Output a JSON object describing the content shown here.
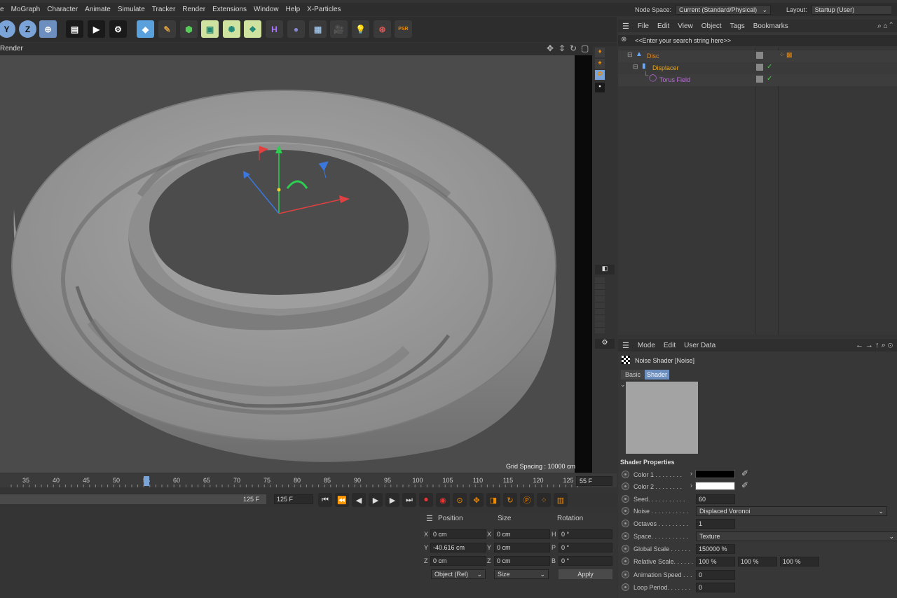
{
  "menubar": {
    "items": [
      "e",
      "MoGraph",
      "Character",
      "Animate",
      "Simulate",
      "Tracker",
      "Render",
      "Extensions",
      "Window",
      "Help",
      "X-Particles"
    ]
  },
  "nodespace": {
    "label": "Node Space:",
    "value": "Current (Standard/Physical)"
  },
  "layout": {
    "label": "Layout:",
    "value": "Startup (User)"
  },
  "viewport": {
    "menu_label": "Render",
    "grid_spacing": "Grid Spacing : 10000 cm"
  },
  "timeline": {
    "ticks": [
      "35",
      "40",
      "45",
      "50",
      "55",
      "60",
      "65",
      "70",
      "75",
      "80",
      "85",
      "90",
      "95",
      "100",
      "105",
      "110",
      "115",
      "120",
      "125"
    ],
    "current_frame": "55 F",
    "end_frame": "125 F",
    "end_frame_field": "125 F"
  },
  "coords": {
    "headers": [
      "Position",
      "Size",
      "Rotation"
    ],
    "rows": [
      {
        "axis": "X",
        "pos": "0 cm",
        "size_axis": "X",
        "size": "0 cm",
        "rot_axis": "H",
        "rot": "0 °"
      },
      {
        "axis": "Y",
        "pos": "-40.616 cm",
        "size_axis": "Y",
        "size": "0 cm",
        "rot_axis": "P",
        "rot": "0 °"
      },
      {
        "axis": "Z",
        "pos": "0 cm",
        "size_axis": "Z",
        "size": "0 cm",
        "rot_axis": "B",
        "rot": "0 °"
      }
    ],
    "mode": "Object (Rel)",
    "size_mode": "Size",
    "apply": "Apply"
  },
  "objmgr": {
    "menu": [
      "File",
      "Edit",
      "View",
      "Object",
      "Tags",
      "Bookmarks"
    ],
    "search_placeholder": "<<Enter your search string here>>",
    "objects": [
      {
        "name": "Disc",
        "color": "#d88a2a"
      },
      {
        "name": "Displacer",
        "color": "#e8a820"
      },
      {
        "name": "Torus Field",
        "color": "#c06ae0"
      }
    ]
  },
  "attrmgr": {
    "menu": [
      "Mode",
      "Edit",
      "User Data"
    ],
    "title": "Noise Shader [Noise]",
    "tabs": [
      "Basic",
      "Shader"
    ],
    "section": "Shader Properties",
    "props": [
      {
        "label": "Color 1 . . . . . . . . ",
        "value": "",
        "kind": "color",
        "color": "#000000"
      },
      {
        "label": "Color 2 . . . . . . . . ",
        "value": "",
        "kind": "color",
        "color": "#ffffff"
      },
      {
        "label": "Seed. . . . . . . . . . .",
        "value": "60",
        "kind": "num"
      },
      {
        "label": "Noise . . . . . . . . . . .",
        "value": "Displaced Voronoi",
        "kind": "select"
      },
      {
        "label": "Octaves . . . . . . . . .",
        "value": "1",
        "kind": "num"
      },
      {
        "label": "Space. . . . . . . . . . .",
        "value": "Texture",
        "kind": "select"
      },
      {
        "label": "Global Scale . . . . . .",
        "value": "150000 %",
        "kind": "num"
      },
      {
        "label": "Relative Scale. . . . . .",
        "value": "100 %",
        "kind": "triple",
        "v2": "100 %",
        "v3": "100 %"
      },
      {
        "label": "Animation Speed . . .",
        "value": "0",
        "kind": "num"
      },
      {
        "label": "Loop Period. . . . . . .",
        "value": "0",
        "kind": "num"
      }
    ]
  }
}
